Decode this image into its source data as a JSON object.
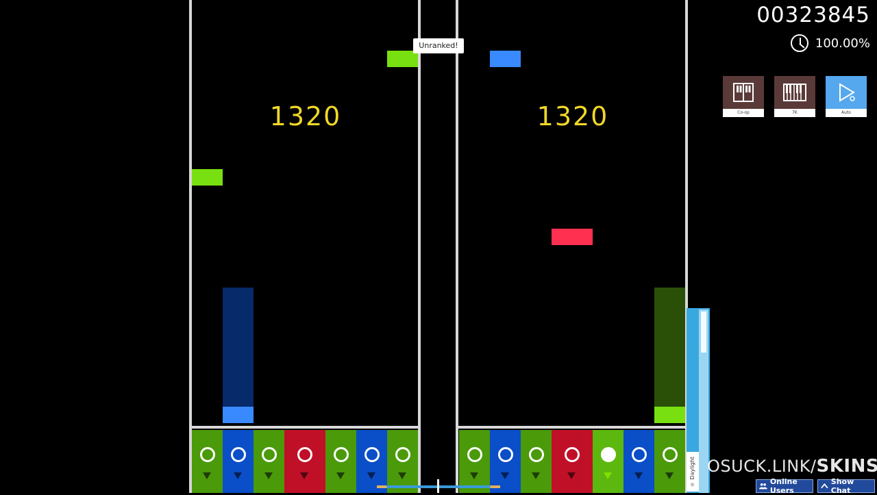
{
  "hud": {
    "score": "00323845",
    "accuracy": "100.00%",
    "unranked_label": "Unranked!",
    "combo_left": "1320",
    "combo_right": "1320"
  },
  "mods": [
    {
      "name": "Co-op",
      "icon": "coop-columns-icon",
      "color": "#5a3a38"
    },
    {
      "name": "7K",
      "icon": "piano-keys-icon",
      "color": "#5a3a38"
    },
    {
      "name": "Auto",
      "icon": "auto-play-icon",
      "color": "#55a8ee"
    }
  ],
  "hp_bar": {
    "label": "Daylight",
    "level": 1.0
  },
  "watermark": {
    "prefix": "OSUCK.LINK/",
    "suffix": "SKINS"
  },
  "bottom_bar": {
    "online_users_label": "Online Users",
    "show_chat_label": "Show Chat"
  },
  "colors": {
    "lane_green": "#4a9a0a",
    "lane_blue": "#0a4ec8",
    "lane_red": "#c01028",
    "note_green": "#78e010",
    "note_blue": "#3a8aff",
    "note_red": "#ff3050",
    "combo_yellow": "#f0d828"
  }
}
